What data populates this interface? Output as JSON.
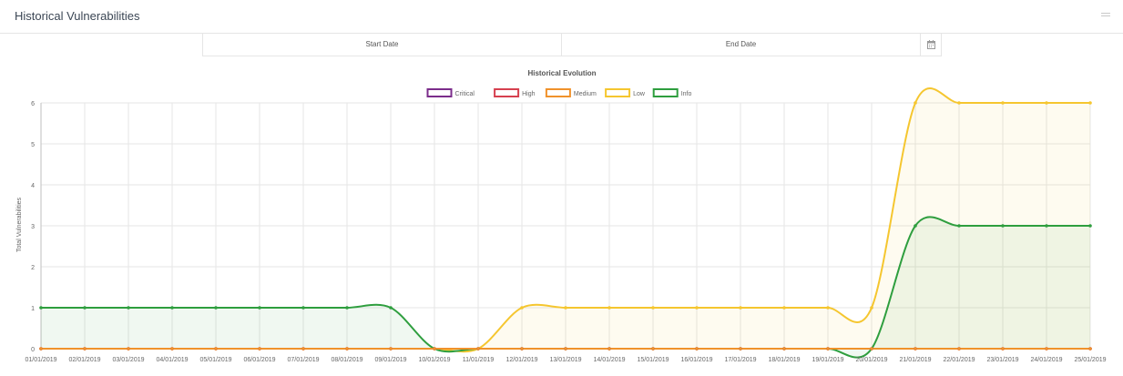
{
  "panel": {
    "title": "Historical Vulnerabilities"
  },
  "date_range": {
    "start_placeholder": "Start Date",
    "end_placeholder": "End Date"
  },
  "colors": {
    "critical": "#7b2d8b",
    "high": "#d6404f",
    "medium": "#f0922b",
    "low": "#f5c62f",
    "info": "#2e9e3e"
  },
  "chart_data": {
    "type": "line",
    "title": "Historical Evolution",
    "xlabel": "",
    "ylabel": "Total Vulnerabilities",
    "ylim": [
      0,
      6
    ],
    "yticks": [
      0,
      1,
      2,
      3,
      4,
      5,
      6
    ],
    "grid": true,
    "legend_position": "top",
    "x": [
      "01/01/2019",
      "02/01/2019",
      "03/01/2019",
      "04/01/2019",
      "05/01/2019",
      "06/01/2019",
      "07/01/2019",
      "08/01/2019",
      "09/01/2019",
      "10/01/2019",
      "11/01/2019",
      "12/01/2019",
      "13/01/2019",
      "14/01/2019",
      "15/01/2019",
      "16/01/2019",
      "17/01/2019",
      "18/01/2019",
      "19/01/2019",
      "20/01/2019",
      "21/01/2019",
      "22/01/2019",
      "23/01/2019",
      "24/01/2019",
      "25/01/2019"
    ],
    "series": [
      {
        "name": "Critical",
        "color": "#7b2d8b",
        "fill": false,
        "values": [
          0,
          0,
          0,
          0,
          0,
          0,
          0,
          0,
          0,
          0,
          0,
          0,
          0,
          0,
          0,
          0,
          0,
          0,
          0,
          0,
          0,
          0,
          0,
          0,
          0
        ]
      },
      {
        "name": "High",
        "color": "#d6404f",
        "fill": false,
        "values": [
          0,
          0,
          0,
          0,
          0,
          0,
          0,
          0,
          0,
          0,
          0,
          0,
          0,
          0,
          0,
          0,
          0,
          0,
          0,
          0,
          0,
          0,
          0,
          0,
          0
        ]
      },
      {
        "name": "Medium",
        "color": "#f0922b",
        "fill": false,
        "values": [
          0,
          0,
          0,
          0,
          0,
          0,
          0,
          0,
          0,
          0,
          0,
          0,
          0,
          0,
          0,
          0,
          0,
          0,
          0,
          0,
          0,
          0,
          0,
          0,
          0
        ]
      },
      {
        "name": "Low",
        "color": "#f5c62f",
        "fill": true,
        "values": [
          0,
          0,
          0,
          0,
          0,
          0,
          0,
          0,
          0,
          0,
          0,
          1,
          1,
          1,
          1,
          1,
          1,
          1,
          1,
          1,
          6,
          6,
          6,
          6,
          6
        ]
      },
      {
        "name": "Info",
        "color": "#2e9e3e",
        "fill": true,
        "values": [
          1,
          1,
          1,
          1,
          1,
          1,
          1,
          1,
          1,
          0,
          0,
          0,
          0,
          0,
          0,
          0,
          0,
          0,
          0,
          0,
          3,
          3,
          3,
          3,
          3
        ]
      }
    ]
  }
}
